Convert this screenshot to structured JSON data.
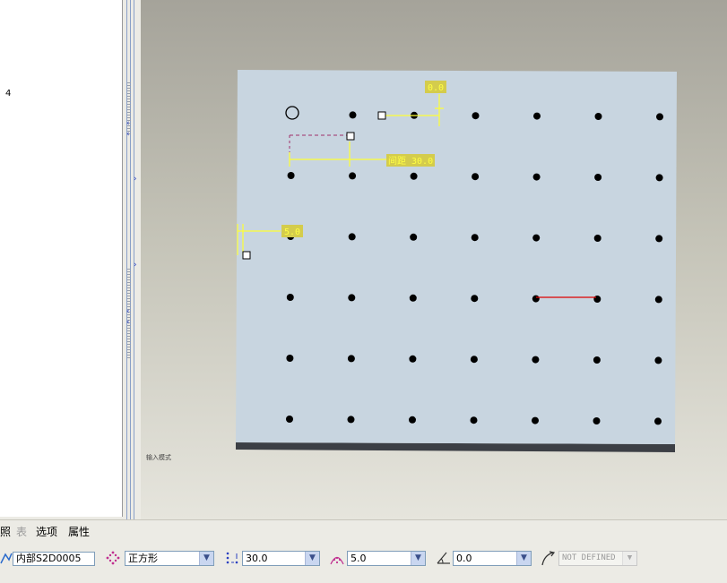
{
  "tree": {
    "item_text": "4"
  },
  "graphics": {
    "status_hint": "输入模式",
    "dimensions": {
      "top": "0.0",
      "spacing": "间距 30.0",
      "left": "5.0"
    },
    "dot_grid": {
      "rows": 6,
      "columns": 7
    }
  },
  "tabs": [
    {
      "label": "照",
      "enabled": true
    },
    {
      "label": "表",
      "enabled": false
    },
    {
      "label": "选项",
      "enabled": true
    },
    {
      "label": "属性",
      "enabled": true
    }
  ],
  "dashboard": {
    "internal_name": "内部S2D0005",
    "pattern_type": "正方形",
    "spacing": "30.0",
    "edge_offset": "5.0",
    "angle": "0.0",
    "reference": "NOT DEFINED"
  },
  "colors": {
    "panel_face": "#c8d5e0",
    "dimension": "#ffff33",
    "dot": "#000000",
    "accent_line": "#dd0000"
  }
}
